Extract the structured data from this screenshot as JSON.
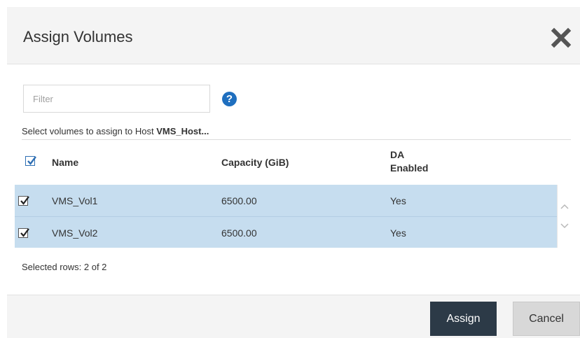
{
  "dialog": {
    "title": "Assign Volumes",
    "close_icon": "close-icon"
  },
  "filter": {
    "placeholder": "Filter",
    "value": "",
    "help_icon": "help-icon",
    "help_glyph": "?"
  },
  "instruction": {
    "prefix": "Select volumes to assign to Host ",
    "host": "VMS_Host..."
  },
  "table": {
    "select_all_checked": true,
    "columns": {
      "name": "Name",
      "capacity": "Capacity (GiB)",
      "da_line1": "DA",
      "da_line2": "Enabled"
    },
    "rows": [
      {
        "checked": true,
        "name": "VMS_Vol1",
        "capacity": "6500.00",
        "da_enabled": "Yes"
      },
      {
        "checked": true,
        "name": "VMS_Vol2",
        "capacity": "6500.00",
        "da_enabled": "Yes"
      }
    ]
  },
  "status": {
    "selected_rows": "Selected rows: 2 of 2"
  },
  "footer": {
    "assign_label": "Assign",
    "cancel_label": "Cancel"
  },
  "colors": {
    "row_selected": "#c6ddef",
    "primary_button": "#2c3a47",
    "help_icon": "#1f6fbf"
  }
}
